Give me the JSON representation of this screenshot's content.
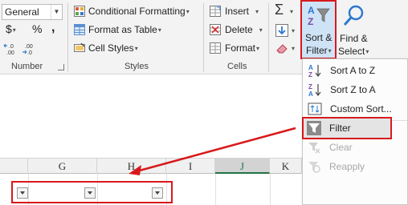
{
  "number_group": {
    "format_value": "General",
    "currency_symbol": "$",
    "percent_symbol": "%",
    "comma_symbol": ",",
    "inc_decimal": "←.0\n.00",
    "dec_decimal": ".00\n→.0",
    "label": "Number"
  },
  "styles_group": {
    "conditional_formatting": "Conditional Formatting",
    "format_as_table": "Format as Table",
    "cell_styles": "Cell Styles",
    "label": "Styles"
  },
  "cells_group": {
    "insert": "Insert",
    "delete": "Delete",
    "format": "Format",
    "label": "Cells"
  },
  "editing_group": {
    "sort_filter_line1": "Sort &",
    "sort_filter_line2": "Filter",
    "find_select_line1": "Find &",
    "find_select_line2": "Select"
  },
  "sort_menu": {
    "items": [
      {
        "label": "Sort A to Z",
        "enabled": true,
        "icon": "sort-a-to-z-icon"
      },
      {
        "label": "Sort Z to A",
        "enabled": true,
        "icon": "sort-z-to-a-icon"
      },
      {
        "label": "Custom Sort...",
        "enabled": true,
        "icon": "custom-sort-icon"
      },
      {
        "label": "Filter",
        "enabled": true,
        "icon": "filter-icon"
      },
      {
        "label": "Clear",
        "enabled": false,
        "icon": "clear-filter-icon"
      },
      {
        "label": "Reapply",
        "enabled": false,
        "icon": "reapply-icon"
      }
    ]
  },
  "sheet": {
    "columns": [
      "G",
      "H",
      "I",
      "J",
      "K"
    ],
    "selected_column": "J"
  },
  "colors": {
    "highlight_red": "#d8191c",
    "excel_green": "#217346",
    "ribbon_bg": "#f3f3f3"
  }
}
